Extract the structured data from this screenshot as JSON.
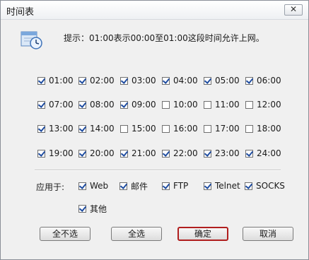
{
  "window": {
    "title": "时间表",
    "close_glyph": "✕"
  },
  "hint": {
    "icon": "calendar-clock-icon",
    "text": "提示：01:00表示00:00至01:00这段时间允许上网。"
  },
  "hours": [
    {
      "label": "01:00",
      "checked": true
    },
    {
      "label": "02:00",
      "checked": true
    },
    {
      "label": "03:00",
      "checked": true
    },
    {
      "label": "04:00",
      "checked": true
    },
    {
      "label": "05:00",
      "checked": true
    },
    {
      "label": "06:00",
      "checked": true
    },
    {
      "label": "07:00",
      "checked": true
    },
    {
      "label": "08:00",
      "checked": true
    },
    {
      "label": "09:00",
      "checked": true
    },
    {
      "label": "10:00",
      "checked": false
    },
    {
      "label": "11:00",
      "checked": false
    },
    {
      "label": "12:00",
      "checked": false
    },
    {
      "label": "13:00",
      "checked": true
    },
    {
      "label": "14:00",
      "checked": true
    },
    {
      "label": "15:00",
      "checked": false
    },
    {
      "label": "16:00",
      "checked": false
    },
    {
      "label": "17:00",
      "checked": false
    },
    {
      "label": "18:00",
      "checked": false
    },
    {
      "label": "19:00",
      "checked": true
    },
    {
      "label": "20:00",
      "checked": true
    },
    {
      "label": "21:00",
      "checked": true
    },
    {
      "label": "22:00",
      "checked": true
    },
    {
      "label": "23:00",
      "checked": true
    },
    {
      "label": "24:00",
      "checked": true
    }
  ],
  "apply": {
    "label": "应用于:",
    "items": [
      {
        "label": "Web",
        "checked": true
      },
      {
        "label": "邮件",
        "checked": true
      },
      {
        "label": "FTP",
        "checked": true
      },
      {
        "label": "Telnet",
        "checked": true
      },
      {
        "label": "SOCKS",
        "checked": true
      },
      {
        "label": "其他",
        "checked": true
      }
    ]
  },
  "buttons": {
    "deselect_all": "全不选",
    "select_all": "全选",
    "ok": "确定",
    "cancel": "取消"
  },
  "colors": {
    "primary_button_border": "#b01e1e",
    "checkmark": "#1e4ca0"
  }
}
